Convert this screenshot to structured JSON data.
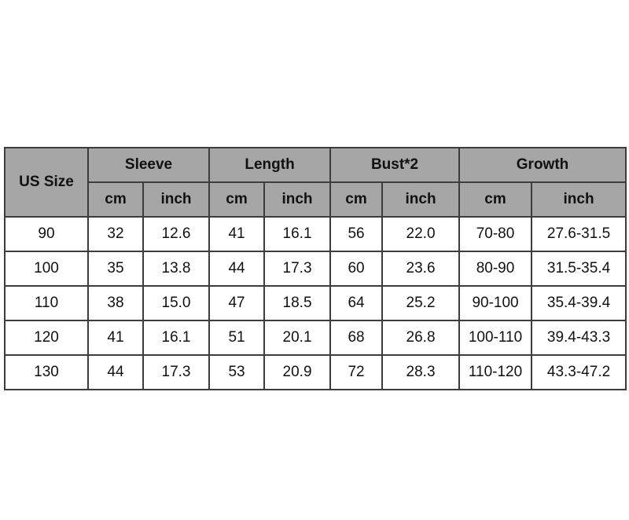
{
  "header": {
    "size_label": "US Size",
    "groups": [
      "Sleeve",
      "Length",
      "Bust*2",
      "Growth"
    ],
    "units": [
      "cm",
      "inch",
      "cm",
      "inch",
      "cm",
      "inch",
      "cm",
      "inch"
    ]
  },
  "rows": [
    [
      "90",
      "32",
      "12.6",
      "41",
      "16.1",
      "56",
      "22.0",
      "70-80",
      "27.6-31.5"
    ],
    [
      "100",
      "35",
      "13.8",
      "44",
      "17.3",
      "60",
      "23.6",
      "80-90",
      "31.5-35.4"
    ],
    [
      "110",
      "38",
      "15.0",
      "47",
      "18.5",
      "64",
      "25.2",
      "90-100",
      "35.4-39.4"
    ],
    [
      "120",
      "41",
      "16.1",
      "51",
      "20.1",
      "68",
      "26.8",
      "100-110",
      "39.4-43.3"
    ],
    [
      "130",
      "44",
      "17.3",
      "53",
      "20.9",
      "72",
      "28.3",
      "110-120",
      "43.3-47.2"
    ]
  ],
  "colors": {
    "header_bg": "#a6a6a6",
    "border": "#3c3c3c"
  }
}
